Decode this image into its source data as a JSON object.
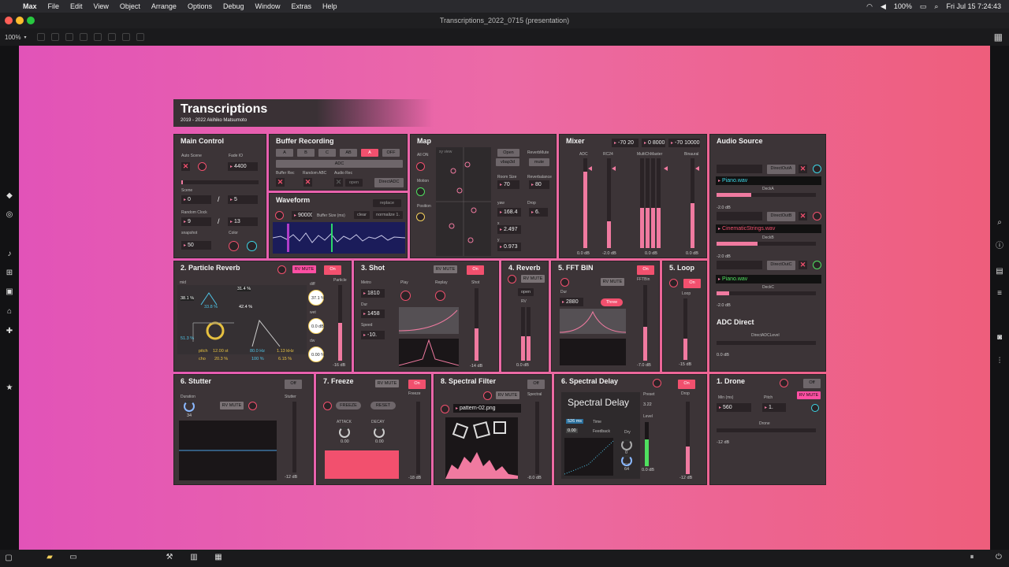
{
  "menubar": {
    "app": "Max",
    "items": [
      "File",
      "Edit",
      "View",
      "Object",
      "Arrange",
      "Options",
      "Debug",
      "Window",
      "Extras",
      "Help"
    ],
    "battery": "100%",
    "clock": "Fri Jul 15  7:24:43"
  },
  "window": {
    "title": "Transcriptions_2022_0715 (presentation)",
    "zoom": "100%"
  },
  "banner": {
    "title": "Transcriptions",
    "subtitle": "2019 - 2022 Akihiko Matsumoto"
  },
  "main_control": {
    "title": "Main Control",
    "auto_scene_label": "Auto Scene",
    "fade_io_label": "Fade IO",
    "fade_io": "4400",
    "scene_label": "Scene",
    "scene": "0",
    "scene_max": "5",
    "slash": "/",
    "random_clock_label": "Random Clock",
    "random_clock": "9",
    "random_clock_max": "13",
    "snapshot_label": "snapshot",
    "snapshot": "50",
    "color_label": "Color"
  },
  "buffer_recording": {
    "title": "Buffer Recording",
    "buttons": [
      "A",
      "B",
      "C",
      "AB",
      "A",
      "OFF"
    ],
    "adc": "ADC",
    "buffer_rec": "Buffer Rec",
    "random_abc": "Random ABC",
    "audio_rec": "Audio Rec",
    "open": "open",
    "direct_adc": "DirectADC"
  },
  "waveform": {
    "title": "Waveform",
    "buffer_size": "90000",
    "buffer_size_label": "Buffer Size (ms)",
    "replace": "replace",
    "clear": "clear",
    "normalize": "normalize 1."
  },
  "map": {
    "title": "Map",
    "all_on": "All ON",
    "motion": "Motion",
    "position": "Position",
    "xy_view": "xy view",
    "open": "Open",
    "vbap3d": "vbap3d",
    "reverb_mute_label": "ReverbMute",
    "mute": "mute",
    "room_size_label": "Room Size",
    "room_size": "70",
    "reverb_balance_label": "Reverbalance",
    "reverb_balance": "80",
    "yaw_label": "yaw",
    "yaw": "168.4",
    "drop_label": "Drop",
    "drop": "6.",
    "x_label": "x",
    "x": "2.497",
    "y_label": "y",
    "y": "0.973"
  },
  "mixer": {
    "title": "Mixer",
    "readouts": [
      "-70 20",
      "0 8000",
      "-70 10000"
    ],
    "channels": [
      {
        "name": "ADC",
        "db": "0.0 dB",
        "level": 0.85
      },
      {
        "name": "RC24",
        "db": "-2.0 dB",
        "level": 0.3
      },
      {
        "name": "MultiChMaster",
        "db": "0.0 dB",
        "level": 0.45
      },
      {
        "name": "Binaural",
        "db": "0.0 dB",
        "level": 0.5
      }
    ]
  },
  "audio_source": {
    "title": "Audio Source",
    "decks": [
      {
        "out": "DirectOutA",
        "file": "Piano.wav",
        "deck": "DeckA",
        "db": "-2.0 dB",
        "ring": "cy"
      },
      {
        "out": "DirectOutB",
        "file": "CinematicStrings.wav",
        "deck": "DeckB",
        "db": "-2.0 dB",
        "ring": "pk"
      },
      {
        "out": "DirectOutC",
        "file": "Piano.wav",
        "deck": "DeckC",
        "db": "-2.0 dB",
        "ring": "gr"
      }
    ],
    "adc_direct_title": "ADC Direct",
    "adc_direct_level": "DirectADCLevel",
    "adc_db": "0.0 dB"
  },
  "particle_reverb": {
    "title": "2. Particle Reverb",
    "rv_mute": "RV MUTE",
    "on": "On",
    "particle": "Particle",
    "mid": "mid",
    "p1": "38.1 %",
    "p2": "33.8 %",
    "p3": "31.4 %",
    "p4": "42.4 %",
    "p5": "51.3 %",
    "diff": "diff",
    "diff_val": "37.1 %",
    "wet": "wet",
    "wet_val": "0.0 dB",
    "dw": "dw",
    "dw_val": "0.00 %",
    "pitch_label": "pitch",
    "pitch": "12.00 st",
    "cho_label": "cho",
    "cho": "20.3 %",
    "hz1": "80.0 Hz",
    "hz2": "1.13 kHz",
    "pct1": "100 %",
    "pct2": "6.15 %",
    "db": "-16 dB"
  },
  "shot": {
    "title": "3. Shot",
    "rv_mute": "RV MUTE",
    "on": "On",
    "metro_label": "Metro",
    "metro": "1810",
    "dur_label": "Dur",
    "dur": "1458",
    "speed_label": "Speed",
    "speed": "-10.",
    "play": "Play",
    "replay": "Replay",
    "shot": "Shot",
    "db": "-14 dB"
  },
  "reverb": {
    "title": "4. Reverb",
    "rv_mute": "RV MUTE",
    "open": "open",
    "rv": "RV",
    "db": "0.0 dB"
  },
  "fft_bin": {
    "title": "5. FFT BIN",
    "rv_mute": "RV MUTE",
    "on": "On",
    "dur_label": "Dur",
    "dur": "2880",
    "three": "Three",
    "fftbin": "FFTBin",
    "db": "-7.0 dB"
  },
  "loop": {
    "title": "5. Loop",
    "on": "On",
    "loop": "Loop",
    "db": "-15 dB"
  },
  "stutter": {
    "title": "6. Stutter",
    "off": "Off",
    "duration_label": "Duration",
    "duration": "34",
    "rv_mute": "RV MUTE",
    "stutter": "Stutter",
    "db": "-12 dB"
  },
  "freeze": {
    "title": "7. Freeze",
    "rv_mute": "RV MUTE",
    "on": "On",
    "freeze_btn": "FREEZE",
    "reset_btn": "RESET",
    "freeze": "Freeze",
    "attack": "ATTACK",
    "decay": "DECAY",
    "attack_val": "0.00",
    "decay_val": "0.00",
    "db": "-18 dB"
  },
  "spectral_filter": {
    "title": "8. Spectral Filter",
    "off": "Off",
    "rv_mute": "RV MUTE",
    "pattern": "pattern-02.png",
    "spectral": "Spectral",
    "db": "-8.0 dB"
  },
  "spectral_delay": {
    "title": "6. Spectral Delay",
    "on": "On",
    "heading": "Spectral Delay",
    "time_val": "526 ms",
    "time": "Time",
    "feedback_val": "0.00",
    "feedback": "Feedback",
    "dry": "Dry",
    "dry_val": "0",
    "fx": "FX",
    "fx_val": "64",
    "preset": "Preset",
    "preset_val": "3.22",
    "level": "Level",
    "drop": "Drop",
    "db_level": "0.0 dB",
    "db": "-12 dB"
  },
  "drone": {
    "title": "1. Drone",
    "off": "Off",
    "rv_mute": "RV MUTE",
    "min_label": "Min (ms)",
    "min": "560",
    "pitch_label": "Pitch",
    "pitch": "1.",
    "drone": "Drone",
    "db": "-12 dB"
  }
}
